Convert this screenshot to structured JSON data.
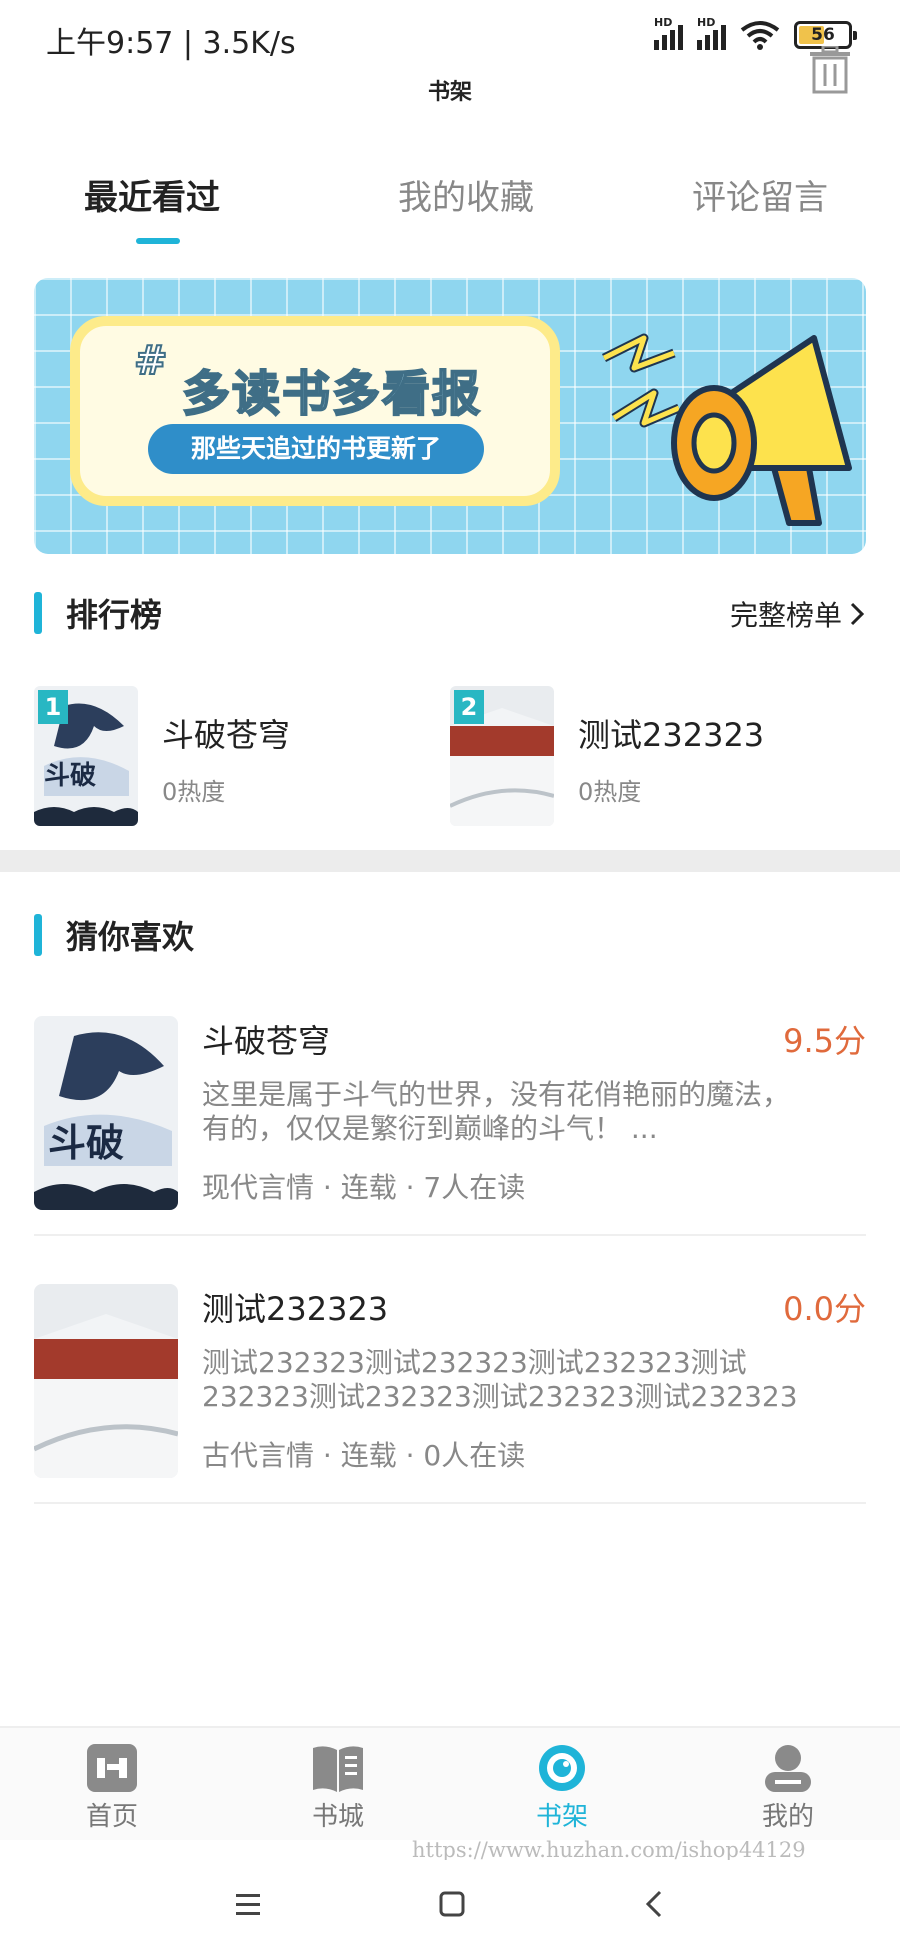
{
  "status_bar": {
    "time": "上午9:57 | 3.5K/s",
    "signal_label": "HD",
    "battery": "56",
    "battery_fraction": 0.56
  },
  "header": {
    "title": "书架",
    "trash_icon": "trash-icon"
  },
  "tabs": [
    {
      "label": "最近看过",
      "active": true
    },
    {
      "label": "我的收藏",
      "active": false
    },
    {
      "label": "评论留言",
      "active": false
    }
  ],
  "banner": {
    "hash": "#",
    "headline": "多读书多看报",
    "pill": "那些天追过的书更新了",
    "icon": "megaphone-icon"
  },
  "ranking": {
    "title": "排行榜",
    "more": "完整榜单",
    "items": [
      {
        "rank": "1",
        "title": "斗破苍穹",
        "heat": "0热度"
      },
      {
        "rank": "2",
        "title": "测试232323",
        "heat": "0热度"
      }
    ]
  },
  "recommend": {
    "title": "猜你喜欢",
    "items": [
      {
        "title": "斗破苍穹",
        "score": "9.5分",
        "desc": "这里是属于斗气的世界，没有花俏艳丽的魔法，有的，仅仅是繁衍到巅峰的斗气！ ...",
        "meta": "现代言情 · 连载 · 7人在读"
      },
      {
        "title": "测试232323",
        "score": "0.0分",
        "desc": "测试232323测试232323测试232323测试232323测试232323测试232323测试232323",
        "meta": "古代言情 · 连载 · 0人在读"
      }
    ]
  },
  "bottom_nav": [
    {
      "label": "首页",
      "icon": "home-icon",
      "active": false
    },
    {
      "label": "书城",
      "icon": "book-icon",
      "active": false
    },
    {
      "label": "书架",
      "icon": "bookshelf-icon",
      "active": true
    },
    {
      "label": "我的",
      "icon": "user-icon",
      "active": false
    }
  ],
  "watermark": "https://www.huzhan.com/ishop44129",
  "colors": {
    "accent": "#1fb4d8",
    "score": "#e06a3c",
    "rank_badge": "#28b7c3"
  }
}
